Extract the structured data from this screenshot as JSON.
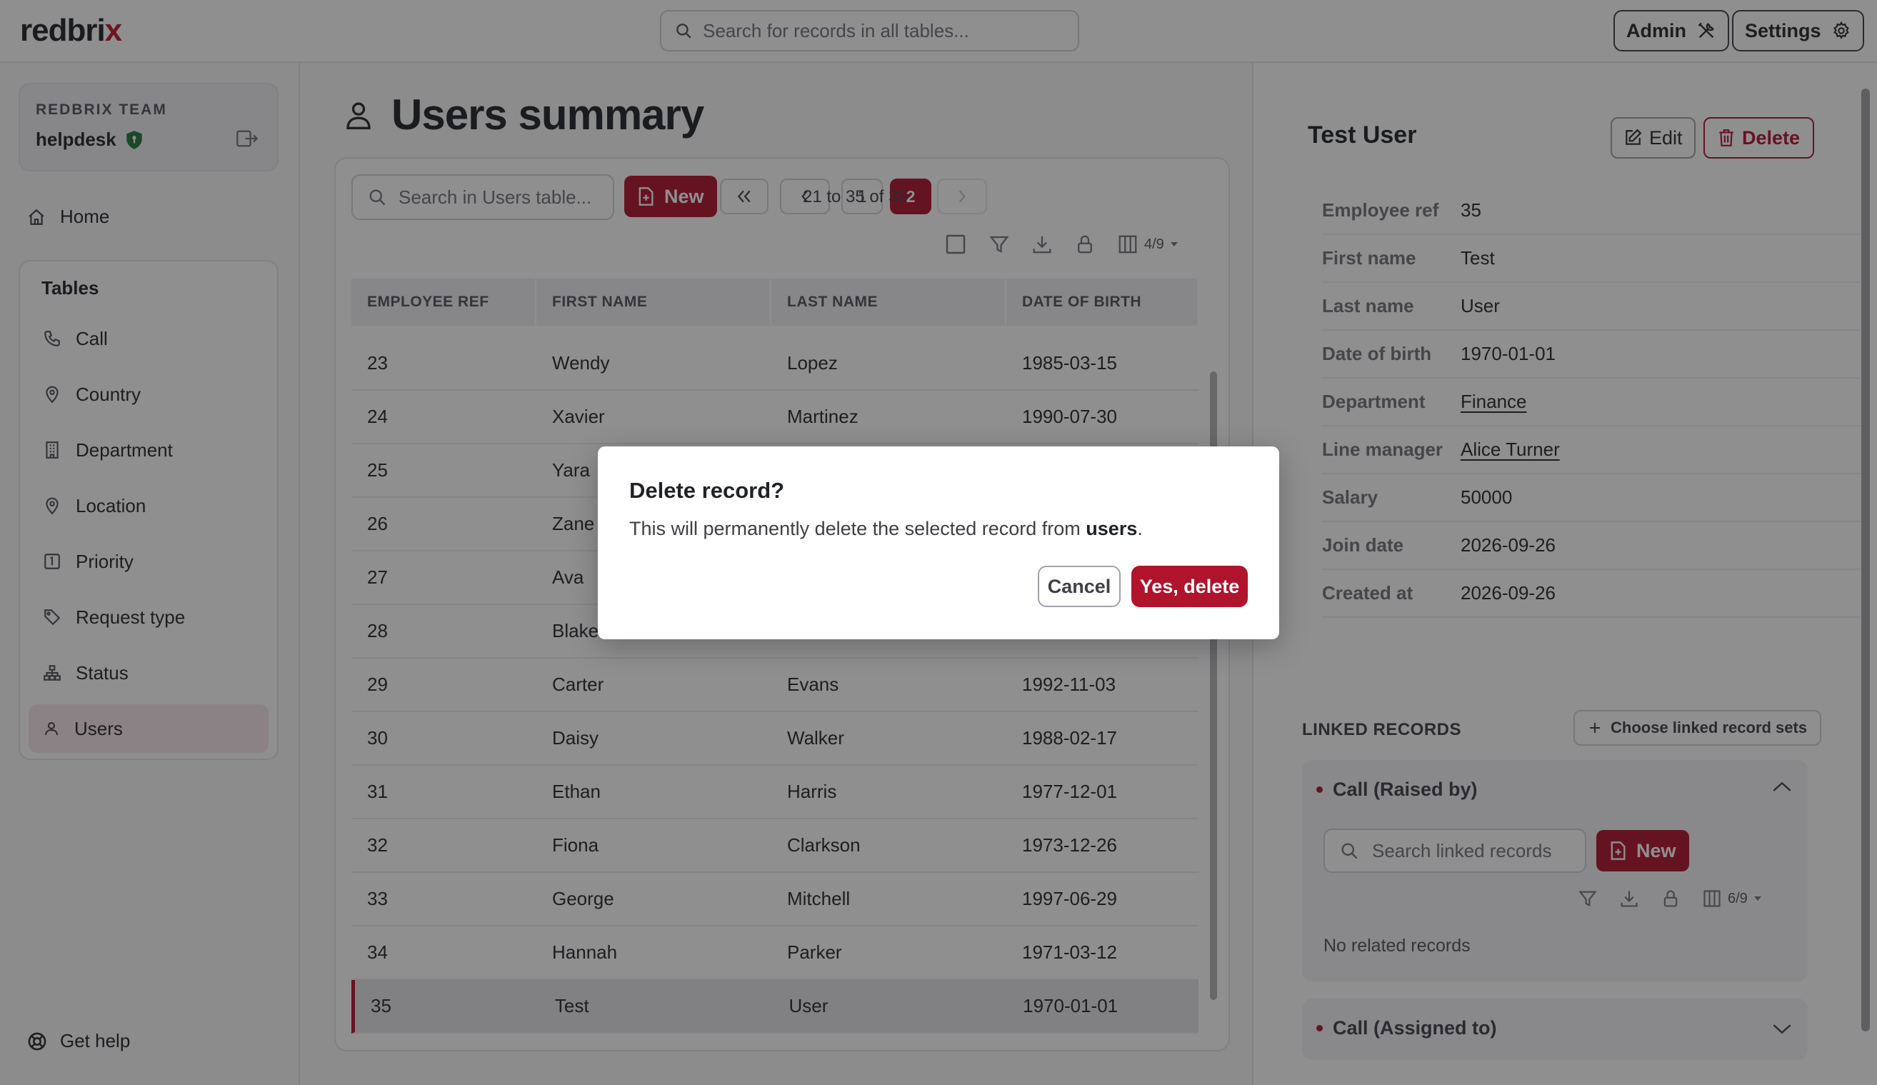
{
  "app": {
    "logo_main": "redbri",
    "logo_accent": "x"
  },
  "topbar": {
    "search_placeholder": "Search for records in all tables...",
    "admin_label": "Admin",
    "settings_label": "Settings"
  },
  "sidebar": {
    "team_label": "REDBRIX TEAM",
    "team_name": "helpdesk",
    "home_label": "Home",
    "tables_title": "Tables",
    "tables": [
      {
        "label": "Call",
        "icon": "phone-icon"
      },
      {
        "label": "Country",
        "icon": "map-pin-icon"
      },
      {
        "label": "Department",
        "icon": "building-icon"
      },
      {
        "label": "Location",
        "icon": "map-pin-icon"
      },
      {
        "label": "Priority",
        "icon": "priority-icon"
      },
      {
        "label": "Request type",
        "icon": "tag-icon"
      },
      {
        "label": "Status",
        "icon": "hierarchy-icon"
      },
      {
        "label": "Users",
        "icon": "user-icon"
      }
    ],
    "active_table": "Users",
    "get_help_label": "Get help"
  },
  "main": {
    "page_title": "Users summary",
    "search_placeholder": "Search in Users table...",
    "new_label": "New",
    "pagination": {
      "pages": [
        "1",
        "2"
      ],
      "current_page": "2",
      "range_text": "21 to 35 of 35"
    },
    "columns_count": "4/9",
    "columns": [
      "EMPLOYEE REF",
      "FIRST NAME",
      "LAST NAME",
      "DATE OF BIRTH"
    ],
    "rows": [
      [
        "23",
        "Wendy",
        "Lopez",
        "1985-03-15"
      ],
      [
        "24",
        "Xavier",
        "Martinez",
        "1990-07-30"
      ],
      [
        "25",
        "Yara",
        "",
        ""
      ],
      [
        "26",
        "Zane",
        "",
        ""
      ],
      [
        "27",
        "Ava",
        "",
        ""
      ],
      [
        "28",
        "Blake",
        "",
        ""
      ],
      [
        "29",
        "Carter",
        "Evans",
        "1992-11-03"
      ],
      [
        "30",
        "Daisy",
        "Walker",
        "1988-02-17"
      ],
      [
        "31",
        "Ethan",
        "Harris",
        "1977-12-01"
      ],
      [
        "32",
        "Fiona",
        "Clarkson",
        "1973-12-26"
      ],
      [
        "33",
        "George",
        "Mitchell",
        "1997-06-29"
      ],
      [
        "34",
        "Hannah",
        "Parker",
        "1971-03-12"
      ],
      [
        "35",
        "Test",
        "User",
        "1970-01-01"
      ]
    ],
    "selected_row": "35"
  },
  "detail": {
    "title": "Test User",
    "edit_label": "Edit",
    "delete_label": "Delete",
    "fields": [
      {
        "label": "Employee ref",
        "value": "35",
        "link": false
      },
      {
        "label": "First name",
        "value": "Test",
        "link": false
      },
      {
        "label": "Last name",
        "value": "User",
        "link": false
      },
      {
        "label": "Date of birth",
        "value": "1970-01-01",
        "link": false
      },
      {
        "label": "Department",
        "value": "Finance",
        "link": true
      },
      {
        "label": "Line manager",
        "value": "Alice Turner",
        "link": true
      },
      {
        "label": "Salary",
        "value": "50000",
        "link": false
      },
      {
        "label": "Join date",
        "value": "2026-09-26",
        "link": false
      },
      {
        "label": "Created at",
        "value": "2026-09-26",
        "link": false
      }
    ],
    "linked_title": "LINKED RECORDS",
    "choose_linked_label": "Choose linked record sets",
    "linked_sets": [
      {
        "title": "Call (Raised by)",
        "expanded": true,
        "search_placeholder": "Search linked records",
        "new_label": "New",
        "columns_count": "6/9",
        "empty_text": "No related records"
      },
      {
        "title": "Call (Assigned to)",
        "expanded": false
      }
    ]
  },
  "modal": {
    "title": "Delete record?",
    "body_prefix": "This will permanently delete the selected record from ",
    "body_table": "users",
    "body_suffix": ".",
    "cancel_label": "Cancel",
    "confirm_label": "Yes, delete"
  },
  "colors": {
    "brand": "#b0132b",
    "overlay": "rgba(20,20,24,0.48)"
  }
}
